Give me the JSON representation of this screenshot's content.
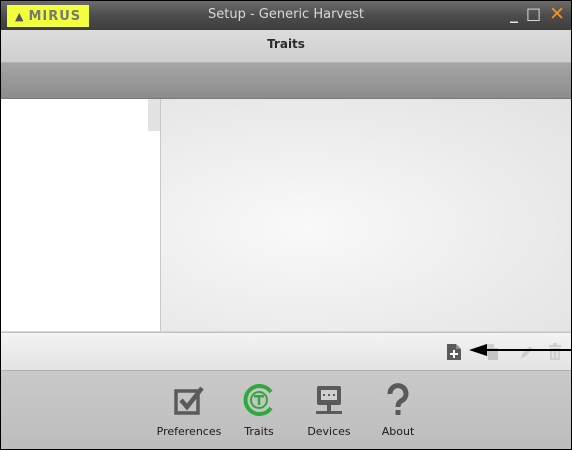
{
  "window": {
    "brand": "MIRUS",
    "title": "Setup - Generic Harvest",
    "controls": {
      "minimize": "_",
      "maximize": "□",
      "close": "✕"
    }
  },
  "header": {
    "title": "Traits"
  },
  "actions": [
    {
      "id": "new",
      "icon": "new-document-icon",
      "enabled": true
    },
    {
      "id": "copy",
      "icon": "copy-icon",
      "enabled": false
    },
    {
      "id": "edit",
      "icon": "pencil-icon",
      "enabled": false
    },
    {
      "id": "delete",
      "icon": "trash-icon",
      "enabled": false
    }
  ],
  "nav": {
    "items": [
      {
        "label": "Preferences",
        "icon": "checkbox-icon"
      },
      {
        "label": "Traits",
        "icon": "traits-icon",
        "active": true
      },
      {
        "label": "Devices",
        "icon": "devices-icon"
      },
      {
        "label": "About",
        "icon": "question-icon"
      }
    ]
  },
  "colors": {
    "brand_highlight": "#f2ff3c",
    "active_green": "#2eaa3c",
    "close_orange": "#f58f1e"
  }
}
